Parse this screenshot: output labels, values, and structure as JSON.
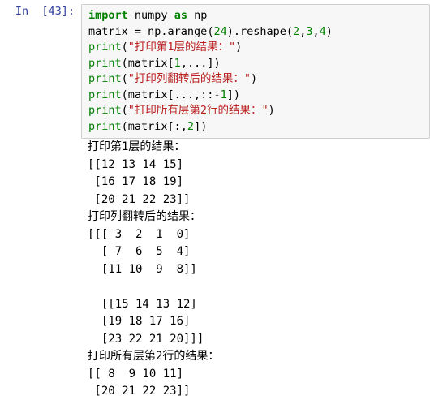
{
  "cell": {
    "prompt": "In  [43]:",
    "code_lines": [
      [
        {
          "t": "import",
          "c": "kw"
        },
        {
          "t": " ",
          "c": "nm"
        },
        {
          "t": "numpy",
          "c": "nm"
        },
        {
          "t": " ",
          "c": "nm"
        },
        {
          "t": "as",
          "c": "kw"
        },
        {
          "t": " ",
          "c": "nm"
        },
        {
          "t": "np",
          "c": "nm"
        }
      ],
      [
        {
          "t": "matrix = np.",
          "c": "nm"
        },
        {
          "t": "arange",
          "c": "nm"
        },
        {
          "t": "(",
          "c": "punct"
        },
        {
          "t": "24",
          "c": "num"
        },
        {
          "t": ").",
          "c": "punct"
        },
        {
          "t": "reshape",
          "c": "nm"
        },
        {
          "t": "(",
          "c": "punct"
        },
        {
          "t": "2",
          "c": "num"
        },
        {
          "t": ",",
          "c": "punct"
        },
        {
          "t": "3",
          "c": "num"
        },
        {
          "t": ",",
          "c": "punct"
        },
        {
          "t": "4",
          "c": "num"
        },
        {
          "t": ")",
          "c": "punct"
        }
      ],
      [
        {
          "t": "print",
          "c": "fn"
        },
        {
          "t": "(",
          "c": "punct"
        },
        {
          "t": "\"打印第1层的结果：\"",
          "c": "str"
        },
        {
          "t": ")",
          "c": "punct"
        }
      ],
      [
        {
          "t": "print",
          "c": "fn"
        },
        {
          "t": "(matrix[",
          "c": "nm"
        },
        {
          "t": "1",
          "c": "num"
        },
        {
          "t": ",...])",
          "c": "nm"
        }
      ],
      [
        {
          "t": "print",
          "c": "fn"
        },
        {
          "t": "(",
          "c": "punct"
        },
        {
          "t": "\"打印列翻转后的结果：\"",
          "c": "str"
        },
        {
          "t": ")",
          "c": "punct"
        }
      ],
      [
        {
          "t": "print",
          "c": "fn"
        },
        {
          "t": "(matrix[...,::",
          "c": "nm"
        },
        {
          "t": "-",
          "c": "op"
        },
        {
          "t": "1",
          "c": "num"
        },
        {
          "t": "])",
          "c": "nm"
        }
      ],
      [
        {
          "t": "print",
          "c": "fn"
        },
        {
          "t": "(",
          "c": "punct"
        },
        {
          "t": "\"打印所有层第2行的结果：\"",
          "c": "str"
        },
        {
          "t": ")",
          "c": "punct"
        }
      ],
      [
        {
          "t": "print",
          "c": "fn"
        },
        {
          "t": "(matrix[:,",
          "c": "nm"
        },
        {
          "t": "2",
          "c": "num"
        },
        {
          "t": "])",
          "c": "nm"
        }
      ]
    ],
    "output_lines": [
      "打印第1层的结果：",
      "[[12 13 14 15]",
      " [16 17 18 19]",
      " [20 21 22 23]]",
      "打印列翻转后的结果：",
      "[[[ 3  2  1  0]",
      "  [ 7  6  5  4]",
      "  [11 10  9  8]]",
      "",
      "  [[15 14 13 12]",
      "  [19 18 17 16]",
      "  [23 22 21 20]]]",
      "打印所有层第2行的结果：",
      "[[ 8  9 10 11]",
      " [20 21 22 23]]"
    ]
  },
  "theme": {
    "keyword_color": "#008000",
    "string_color": "#BA2121",
    "number_color": "#008000",
    "prompt_color": "#303F9F",
    "cell_background": "#f7f7f7",
    "cell_border": "#cfcfcf",
    "page_background": "#ffffff",
    "text_color": "#000000"
  }
}
